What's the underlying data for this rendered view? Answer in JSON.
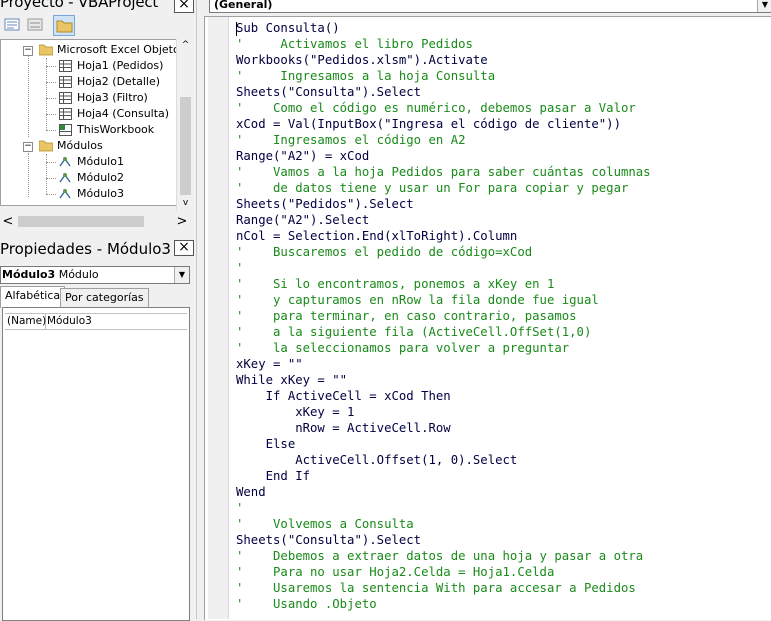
{
  "project_pane": {
    "title": "Proyecto - VBAProject",
    "close_label": "×",
    "toolbar": [
      "view-code-button",
      "view-object-button",
      "toggle-folders-button"
    ],
    "tree": {
      "group_excel": "Microsoft Excel Objetos",
      "sheets": [
        "Hoja1 (Pedidos)",
        "Hoja2 (Detalle)",
        "Hoja3 (Filtro)",
        "Hoja4 (Consulta)",
        "ThisWorkbook"
      ],
      "group_modules": "Módulos",
      "modules": [
        "Módulo1",
        "Módulo2",
        "Módulo3"
      ],
      "expander_symbol": "−"
    },
    "scroll_left": "<",
    "scroll_right": ">",
    "scroll_up": "^",
    "scroll_down": "v"
  },
  "properties_pane": {
    "title": "Propiedades - Módulo3",
    "close_label": "×",
    "object_select_name": "Módulo3",
    "object_select_type": "Módulo",
    "tabs": [
      "Alfabética",
      "Por categorías"
    ],
    "row_name": "(Name)",
    "row_value": "Módulo3"
  },
  "code_pane": {
    "object_combo": "(General)",
    "lines": [
      {
        "t": "code",
        "s": "Sub Consulta()"
      },
      {
        "t": "comment",
        "s": "'     Activamos el libro Pedidos"
      },
      {
        "t": "code",
        "s": "Workbooks(\"Pedidos.xlsm\").Activate"
      },
      {
        "t": "comment",
        "s": "'     Ingresamos a la hoja Consulta"
      },
      {
        "t": "code",
        "s": "Sheets(\"Consulta\").Select"
      },
      {
        "t": "comment",
        "s": "'    Como el código es numérico, debemos pasar a Valor"
      },
      {
        "t": "code",
        "s": "xCod = Val(InputBox(\"Ingresa el código de cliente\"))"
      },
      {
        "t": "comment",
        "s": "'    Ingresamos el código en A2"
      },
      {
        "t": "code",
        "s": "Range(\"A2\") = xCod"
      },
      {
        "t": "comment",
        "s": "'    Vamos a la hoja Pedidos para saber cuántas columnas"
      },
      {
        "t": "comment",
        "s": "'    de datos tiene y usar un For para copiar y pegar"
      },
      {
        "t": "code",
        "s": "Sheets(\"Pedidos\").Select"
      },
      {
        "t": "code",
        "s": "Range(\"A2\").Select"
      },
      {
        "t": "code",
        "s": "nCol = Selection.End(xlToRight).Column"
      },
      {
        "t": "comment",
        "s": "'    Buscaremos el pedido de código=xCod"
      },
      {
        "t": "comment",
        "s": "'"
      },
      {
        "t": "comment",
        "s": "'    Si lo encontramos, ponemos a xKey en 1"
      },
      {
        "t": "comment",
        "s": "'    y capturamos en nRow la fila donde fue igual"
      },
      {
        "t": "comment",
        "s": "'    para terminar, en caso contrario, pasamos"
      },
      {
        "t": "comment",
        "s": "'    a la siguiente fila (ActiveCell.OffSet(1,0)"
      },
      {
        "t": "comment",
        "s": "'    la seleccionamos para volver a preguntar"
      },
      {
        "t": "code",
        "s": "xKey = \"\""
      },
      {
        "t": "code",
        "s": "While xKey = \"\""
      },
      {
        "t": "code",
        "s": "    If ActiveCell = xCod Then"
      },
      {
        "t": "code",
        "s": "        xKey = 1"
      },
      {
        "t": "code",
        "s": "        nRow = ActiveCell.Row"
      },
      {
        "t": "code",
        "s": "    Else"
      },
      {
        "t": "code",
        "s": "        ActiveCell.Offset(1, 0).Select"
      },
      {
        "t": "code",
        "s": "    End If"
      },
      {
        "t": "code",
        "s": "Wend"
      },
      {
        "t": "comment",
        "s": "'"
      },
      {
        "t": "comment",
        "s": "'    Volvemos a Consulta"
      },
      {
        "t": "code",
        "s": "Sheets(\"Consulta\").Select"
      },
      {
        "t": "comment",
        "s": "'    Debemos a extraer datos de una hoja y pasar a otra"
      },
      {
        "t": "comment",
        "s": "'    Para no usar Hoja2.Celda = Hoja1.Celda"
      },
      {
        "t": "comment",
        "s": "'    Usaremos la sentencia With para accesar a Pedidos"
      },
      {
        "t": "comment",
        "s": "'    Usando .Objeto"
      }
    ]
  },
  "colors": {
    "comment": "#1a8a1a",
    "code": "#000040",
    "panel_bg": "#f0f0f0"
  }
}
